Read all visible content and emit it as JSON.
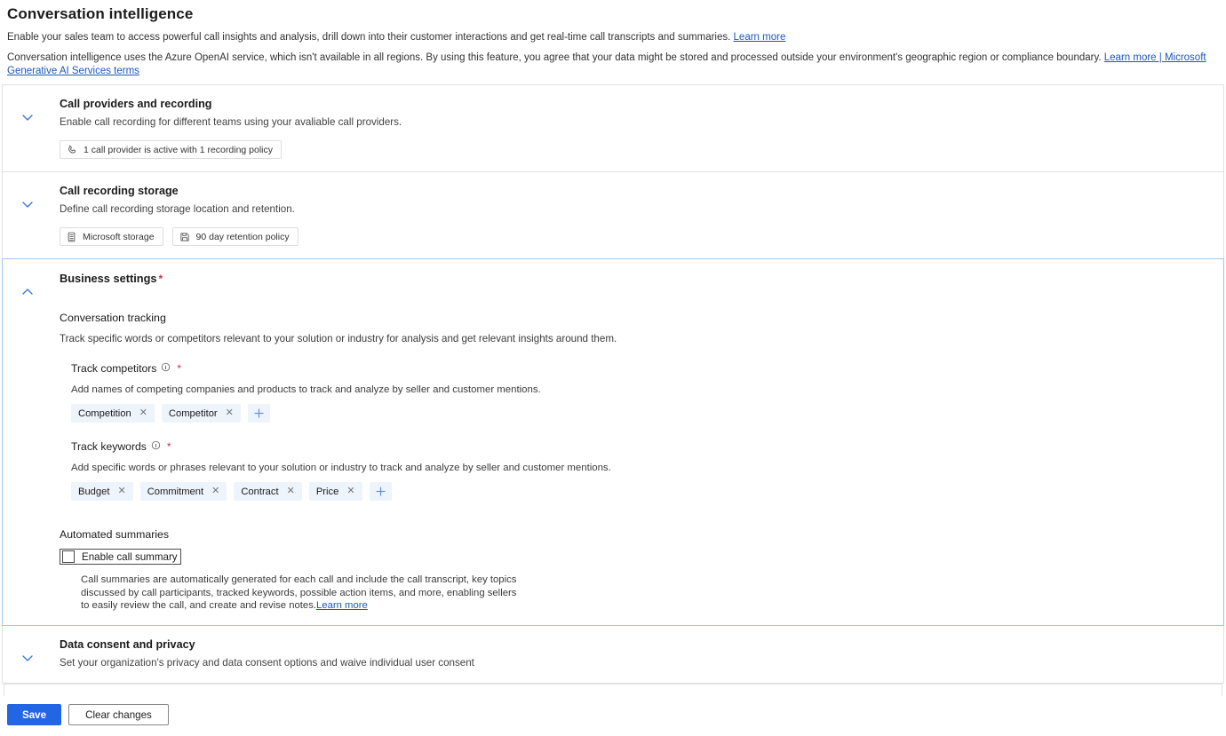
{
  "header": {
    "title": "Conversation intelligence",
    "intro1_text": "Enable your sales team to access powerful call insights and analysis, drill down into their customer interactions and get real-time call transcripts and summaries.",
    "intro1_link": "Learn more",
    "intro2_text": "Conversation intelligence uses the Azure OpenAI service, which isn't available in all regions. By using this feature, you agree that your data might be stored and processed outside your environment's geographic region or compliance boundary.",
    "intro2_link": "Learn more | Microsoft Generative AI Services terms"
  },
  "sections": {
    "call_providers": {
      "title": "Call providers and recording",
      "subtitle": "Enable call recording for different teams using your avaliable call providers.",
      "badge": "1 call provider is active with 1 recording policy",
      "badge_icon": "phone-icon",
      "chevron": "chevron-down-icon"
    },
    "call_storage": {
      "title": "Call recording storage",
      "subtitle": "Define call recording storage location and retention.",
      "badge1": "Microsoft storage",
      "badge1_icon": "database-icon",
      "badge2": "90 day retention policy",
      "badge2_icon": "save-icon",
      "chevron": "chevron-down-icon"
    },
    "business_settings": {
      "title": "Business settings",
      "required_mark": "*",
      "chevron": "chevron-up-icon",
      "conversation_tracking": {
        "heading": "Conversation tracking",
        "description": "Track specific words or competitors relevant to your solution or industry for analysis and get relevant insights around them."
      },
      "track_competitors": {
        "label": "Track competitors",
        "required_mark": "*",
        "info_icon": "info-icon",
        "description": "Add names of competing companies and products to track and analyze by seller and customer mentions.",
        "tags": [
          "Competition",
          "Competitor"
        ],
        "add_label": "+"
      },
      "track_keywords": {
        "label": "Track keywords",
        "required_mark": "*",
        "info_icon": "info-icon",
        "description": "Add specific words or phrases relevant to your solution or industry to track and analyze by seller and customer mentions.",
        "tags": [
          "Budget",
          "Commitment",
          "Contract",
          "Price"
        ],
        "add_label": "+"
      },
      "automated_summaries": {
        "heading": "Automated summaries",
        "checkbox_label": "Enable call summary",
        "checked": false,
        "description": "Call summaries are automatically generated for each call and include the call transcript, key topics discussed by call participants, tracked keywords, possible action items, and more, enabling sellers to easily review the call, and create and revise notes.",
        "link": "Learn more"
      }
    },
    "data_consent": {
      "title": "Data consent and privacy",
      "subtitle": "Set your organization's privacy and data consent options and waive individual user consent",
      "chevron": "chevron-down-icon"
    }
  },
  "footer": {
    "save_label": "Save",
    "clear_label": "Clear changes"
  },
  "colors": {
    "accent": "#2266e3",
    "chevron": "#3b78d8",
    "link": "#1a56c4",
    "required": "#c4314b",
    "pill_bg": "#eef4fb",
    "expanded_border": "#9ec5f0"
  }
}
